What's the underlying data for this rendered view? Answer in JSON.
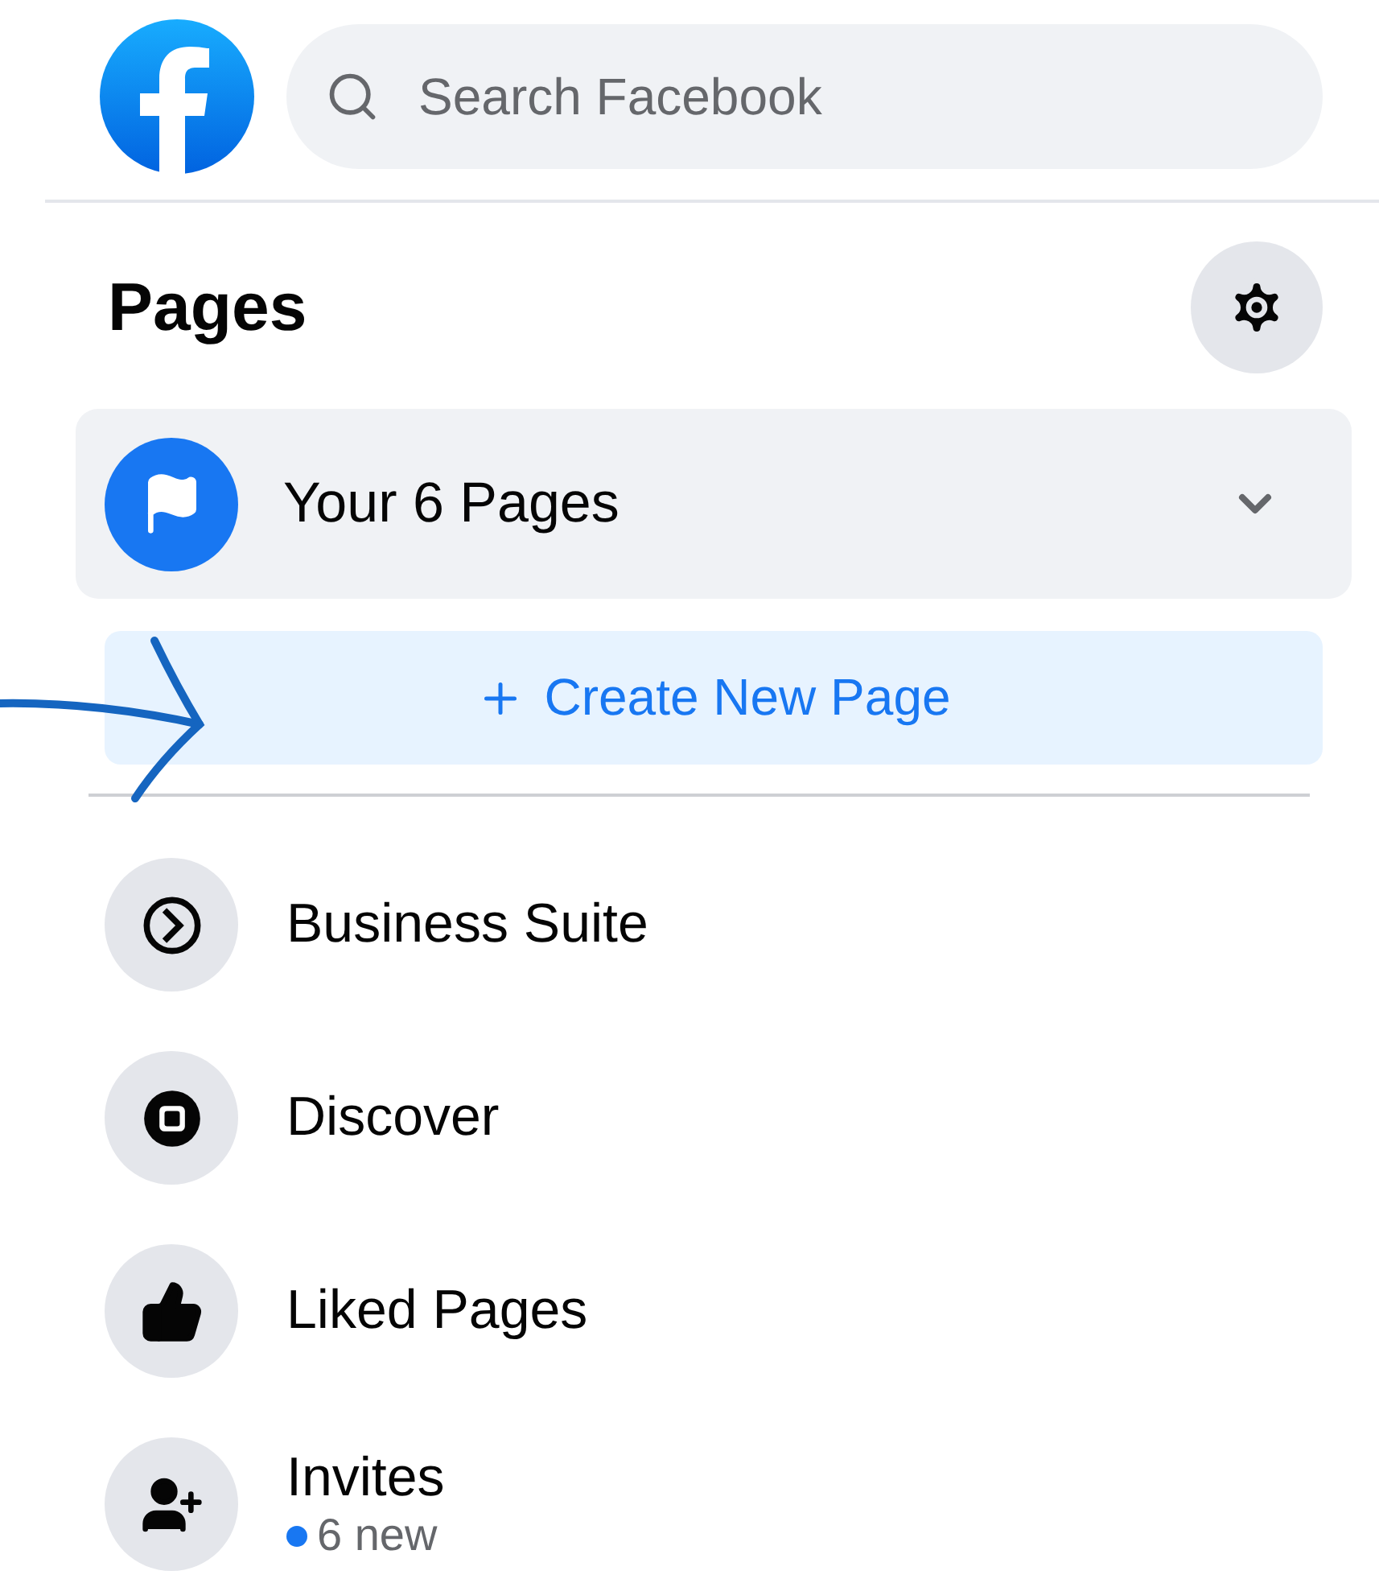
{
  "search": {
    "placeholder": "Search Facebook"
  },
  "heading": "Pages",
  "your_pages": {
    "label": "Your 6 Pages",
    "expanded": false
  },
  "create_button": {
    "label": "Create New Page"
  },
  "items": [
    {
      "kind": "suite",
      "label": "Business Suite"
    },
    {
      "kind": "discover",
      "label": "Discover"
    },
    {
      "kind": "liked",
      "label": "Liked Pages"
    },
    {
      "kind": "invites",
      "label": "Invites",
      "note": "6 new"
    }
  ]
}
